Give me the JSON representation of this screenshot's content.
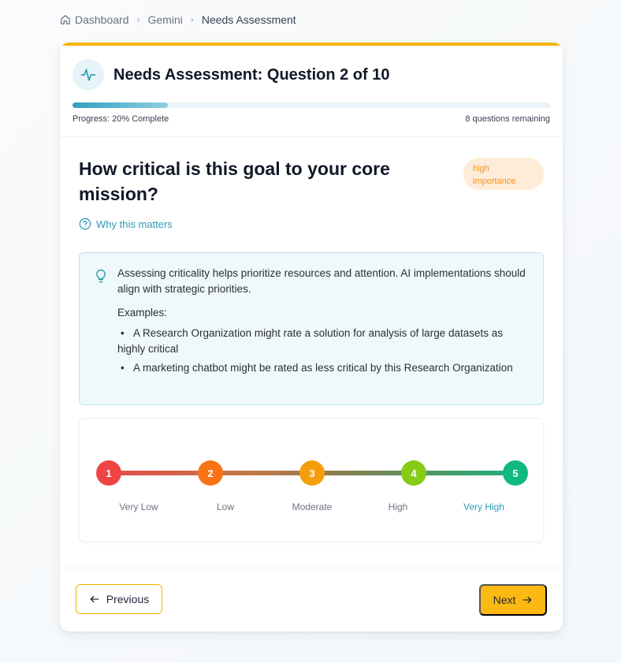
{
  "breadcrumb": {
    "items": [
      "Dashboard",
      "Gemini",
      "Needs Assessment"
    ]
  },
  "header": {
    "icon": "activity-pulse-icon",
    "title": "Needs Assessment: Question 2 of 10",
    "progress_label": "Progress: 20% Complete",
    "progress_value": 0.2,
    "remaining_label": "8 questions remaining"
  },
  "question": {
    "text": "How critical is this goal to your core mission?",
    "badge": "high importance",
    "why_label": "Why this matters"
  },
  "info": {
    "text": "Assessing criticality helps prioritize resources and attention. AI implementations should align with strategic priorities.",
    "examples_label": "Examples:",
    "examples": [
      "A Research Organization might rate a solution for analysis of large datasets as highly critical",
      "A marketing chatbot might be rated as less critical by this Research Organization"
    ]
  },
  "scale": {
    "selected": 5,
    "points": [
      {
        "value": "1",
        "label": "Very Low",
        "color": "#ef4444"
      },
      {
        "value": "2",
        "label": "Low",
        "color": "#f97316"
      },
      {
        "value": "3",
        "label": "Moderate",
        "color": "#f59e0b"
      },
      {
        "value": "4",
        "label": "High",
        "color": "#84cc16"
      },
      {
        "value": "5",
        "label": "Very High",
        "color": "#10b981"
      }
    ]
  },
  "footer": {
    "previous_label": "Previous",
    "next_label": "Next"
  },
  "colors": {
    "accent": "#f6b400",
    "teal": "#2d9bb6"
  }
}
